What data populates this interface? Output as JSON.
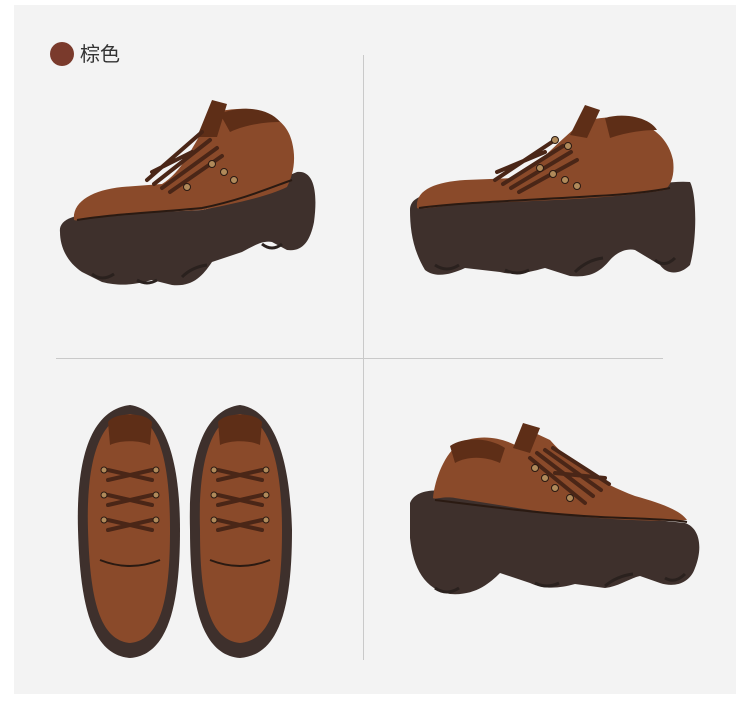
{
  "color_option": {
    "label": "棕色",
    "swatch_color": "#7a3a2c"
  },
  "colors": {
    "leather": "#8a4a2a",
    "leather_dark": "#5e2e17",
    "sole": "#3e302c",
    "sole_dark": "#2a211e",
    "lace": "#4a2617",
    "eyelet": "#b08a5a"
  },
  "product_views": [
    {
      "name": "side-left-view"
    },
    {
      "name": "side-right-view"
    },
    {
      "name": "top-pair-view"
    },
    {
      "name": "side-back-view"
    }
  ]
}
